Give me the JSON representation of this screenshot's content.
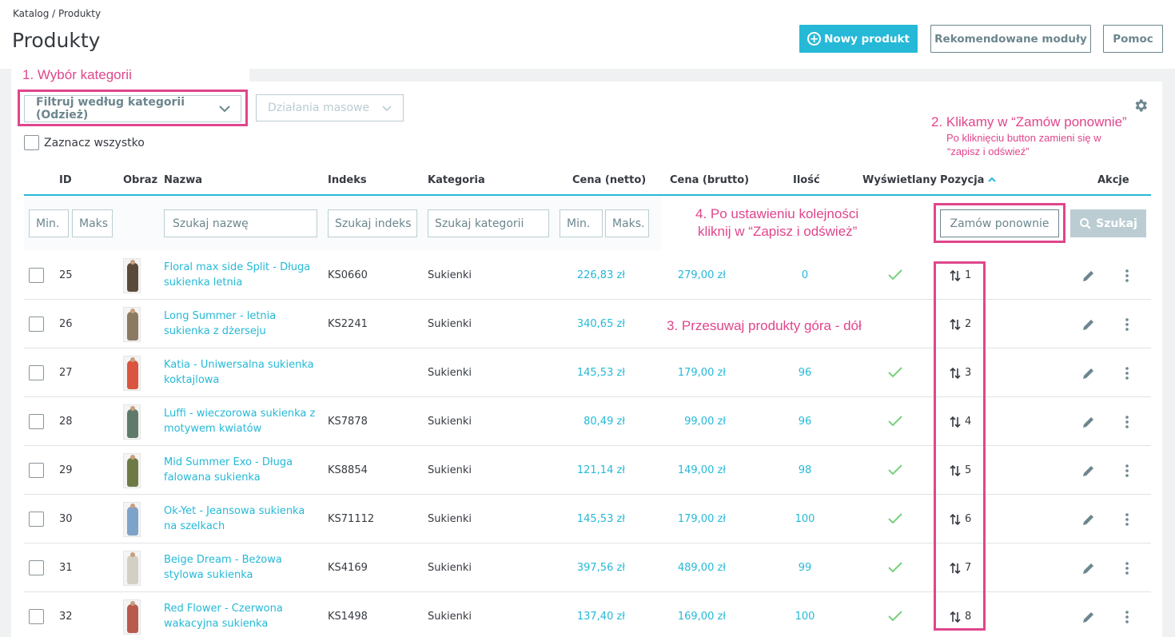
{
  "header": {
    "breadcrumb": "Katalog /  Produkty",
    "title": "Produkty",
    "new_product_button": "Nowy produkt",
    "recommended_button": "Rekomendowane moduły",
    "help_button": "Pomoc"
  },
  "annotations": {
    "a1": "1. Wybór kategorii",
    "a2_title": "2. Klikamy w “Zamów ponownie”",
    "a2_sub_1": "Po kliknięciu button zamieni się w",
    "a2_sub_2": "“zapisz i odświeź”",
    "a3": "3. Przesuwaj produkty góra - dół",
    "a4_line1": "4. Po ustawieniu kolejności",
    "a4_line2": "kliknij w “Zapisz i odśwież”"
  },
  "toolbar": {
    "category_filter": "Filtruj według kategorii (Odzież)",
    "bulk_actions": "Działania masowe",
    "select_all": "Zaznacz wszystko"
  },
  "columns": {
    "id": "ID",
    "image": "Obraz",
    "name": "Nazwa",
    "reference": "Indeks",
    "category": "Kategoria",
    "price_net": "Cena (netto)",
    "price_gross": "Cena (brutto)",
    "quantity": "Ilość",
    "active": "Wyświetlany",
    "position": "Pozycja",
    "actions": "Akcje"
  },
  "filters": {
    "id_min": "Min.",
    "id_max": "Maks",
    "name": "Szukaj nazwę",
    "reference": "Szukaj indeks",
    "category": "Szukaj kategorii",
    "price_min": "Min.",
    "price_max": "Maks.",
    "reorder_button": "Zamów ponownie",
    "search_button": "Szukaj"
  },
  "rows": [
    {
      "id": "25",
      "name": "Floral max side Split - Długa sukienka letnia",
      "reference": "KS0660",
      "category": "Sukienki",
      "price_net": "226,83 zł",
      "price_gross": "279,00 zł",
      "quantity": "0",
      "active": true,
      "position": "1",
      "dress_color": "#5a4a3a"
    },
    {
      "id": "26",
      "name": "Long Summer - letnia sukienka z dżerseju",
      "reference": "KS2241",
      "category": "Sukienki",
      "price_net": "340,65 zł",
      "price_gross": "",
      "quantity": "",
      "active": false,
      "position": "2",
      "dress_color": "#8a7a62"
    },
    {
      "id": "27",
      "name": "Katia - Uniwersalna sukienka koktajlowa",
      "reference": "",
      "category": "Sukienki",
      "price_net": "145,53 zł",
      "price_gross": "179,00 zł",
      "quantity": "96",
      "active": true,
      "position": "3",
      "dress_color": "#d9553f"
    },
    {
      "id": "28",
      "name": "Luffi - wieczorowa sukienka z motywem kwiatów",
      "reference": "KS7878",
      "category": "Sukienki",
      "price_net": "80,49 zł",
      "price_gross": "99,00 zł",
      "quantity": "96",
      "active": true,
      "position": "4",
      "dress_color": "#5f7a6a"
    },
    {
      "id": "29",
      "name": "Mid Summer Exo - Długa falowana sukienka",
      "reference": "KS8854",
      "category": "Sukienki",
      "price_net": "121,14 zł",
      "price_gross": "149,00 zł",
      "quantity": "98",
      "active": true,
      "position": "5",
      "dress_color": "#6d7a45"
    },
    {
      "id": "30",
      "name": "Ok-Yet - Jeansowa sukienka na szelkach",
      "reference": "KS71112",
      "category": "Sukienki",
      "price_net": "145,53 zł",
      "price_gross": "179,00 zł",
      "quantity": "100",
      "active": true,
      "position": "6",
      "dress_color": "#7ea3c9"
    },
    {
      "id": "31",
      "name": "Beige Dream - Beżowa stylowa sukienka",
      "reference": "KS4169",
      "category": "Sukienki",
      "price_net": "397,56 zł",
      "price_gross": "489,00 zł",
      "quantity": "99",
      "active": true,
      "position": "7",
      "dress_color": "#d4cfc4"
    },
    {
      "id": "32",
      "name": "Red Flower - Czerwona wakacyjna sukienka",
      "reference": "KS1498",
      "category": "Sukienki",
      "price_net": "137,40 zł",
      "price_gross": "169,00 zł",
      "quantity": "100",
      "active": true,
      "position": "8",
      "dress_color": "#b85a4e"
    }
  ]
}
